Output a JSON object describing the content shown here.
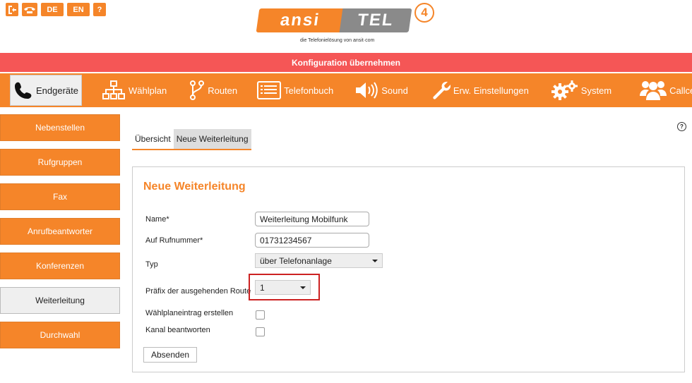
{
  "top_icons": [
    {
      "icon": "logout-icon",
      "label": ""
    },
    {
      "icon": "phone-hangup-icon",
      "label": ""
    },
    {
      "icon": "lang-de",
      "label": "DE"
    },
    {
      "icon": "lang-en",
      "label": "EN"
    },
    {
      "icon": "help-icon",
      "label": "?"
    }
  ],
  "logo": {
    "ansi": "ansi",
    "tel": "TEL",
    "version": "4",
    "tagline": "die Telefonielösung von ansit·com"
  },
  "apply_bar": {
    "label": "Konfiguration übernehmen"
  },
  "nav": [
    {
      "label": "Endgeräte",
      "icon": "phone-icon",
      "active": true
    },
    {
      "label": "Wählplan",
      "icon": "sitemap-icon"
    },
    {
      "label": "Routen",
      "icon": "route-icon"
    },
    {
      "label": "Telefonbuch",
      "icon": "list-icon"
    },
    {
      "label": "Sound",
      "icon": "speaker-icon"
    },
    {
      "label": "Erw. Einstellungen",
      "icon": "wrench-icon"
    },
    {
      "label": "System",
      "icon": "gears-icon"
    },
    {
      "label": "Callcenter",
      "icon": "users-icon"
    }
  ],
  "sidebar": [
    {
      "label": "Nebenstellen"
    },
    {
      "label": "Rufgruppen"
    },
    {
      "label": "Fax"
    },
    {
      "label": "Anrufbeantworter"
    },
    {
      "label": "Konferenzen"
    },
    {
      "label": "Weiterleitung",
      "active": true
    },
    {
      "label": "Durchwahl"
    }
  ],
  "help": {
    "label": "?"
  },
  "tabs": [
    {
      "label": "Übersicht"
    },
    {
      "label": "Neue Weiterleitung"
    }
  ],
  "form": {
    "title": "Neue Weiterleitung",
    "name_label": "Name*",
    "name_value": "Weiterleitung Mobilfunk",
    "number_label": "Auf Rufnummer*",
    "number_value": "01731234567",
    "type_label": "Typ",
    "type_value": "über Telefonanlage",
    "prefix_label": "Präfix der ausgehenden Route",
    "prefix_value": "1",
    "dialplan_label": "Wählplaneintrag erstellen",
    "answer_label": "Kanal beantworten",
    "submit_label": "Absenden"
  },
  "colors": {
    "accent": "#f58529",
    "apply_bar": "#f55656",
    "highlight": "#cc2222"
  }
}
